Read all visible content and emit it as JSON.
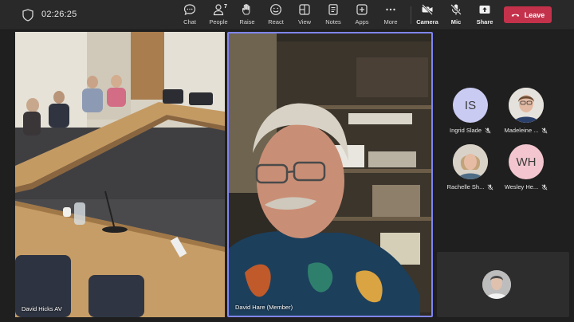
{
  "meeting": {
    "elapsed_time": "02:26:25"
  },
  "toolbar": {
    "chat": "Chat",
    "people": "People",
    "people_count": "7",
    "raise": "Raise",
    "react": "React",
    "view": "View",
    "notes": "Notes",
    "apps": "Apps",
    "more": "More",
    "camera": "Camera",
    "mic": "Mic",
    "share": "Share",
    "leave": "Leave",
    "leave_color": "#c4314b"
  },
  "videos": [
    {
      "name": "David Hicks AV"
    },
    {
      "name": "David Hare (Member)",
      "active_speaker_color": "#7f85f5"
    }
  ],
  "participants": [
    {
      "initials": "IS",
      "name": "Ingrid Slade",
      "avatar_color": "#c9cbf2",
      "muted": true
    },
    {
      "initials": "",
      "name": "Madeleine ...",
      "avatar_color": "#d9d4cf",
      "muted": true
    },
    {
      "initials": "",
      "name": "Rachelle Sh...",
      "avatar_color": "#d8cfc6",
      "muted": true
    },
    {
      "initials": "WH",
      "name": "Wesley He...",
      "avatar_color": "#f3c6cf",
      "muted": true
    }
  ]
}
